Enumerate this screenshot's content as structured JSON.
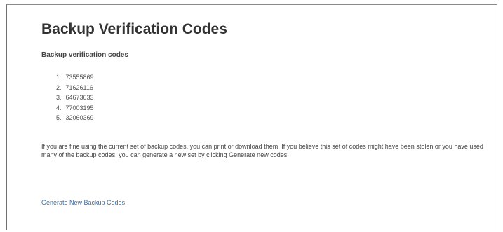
{
  "page": {
    "title": "Backup Verification Codes",
    "subtitle": "Backup verification codes",
    "codes": [
      {
        "number": "1.",
        "code": "73555869"
      },
      {
        "number": "2.",
        "code": "71626116"
      },
      {
        "number": "3.",
        "code": "64673633"
      },
      {
        "number": "4.",
        "code": "77003195"
      },
      {
        "number": "5.",
        "code": "32060369"
      }
    ],
    "info_text": "If you are fine using the current set of backup codes, you can print or download them. If you believe this set of codes might have been stolen or you have used many of the backup codes, you can generate a new set by clicking Generate new codes.",
    "generate_link": "Generate New Backup Codes"
  }
}
